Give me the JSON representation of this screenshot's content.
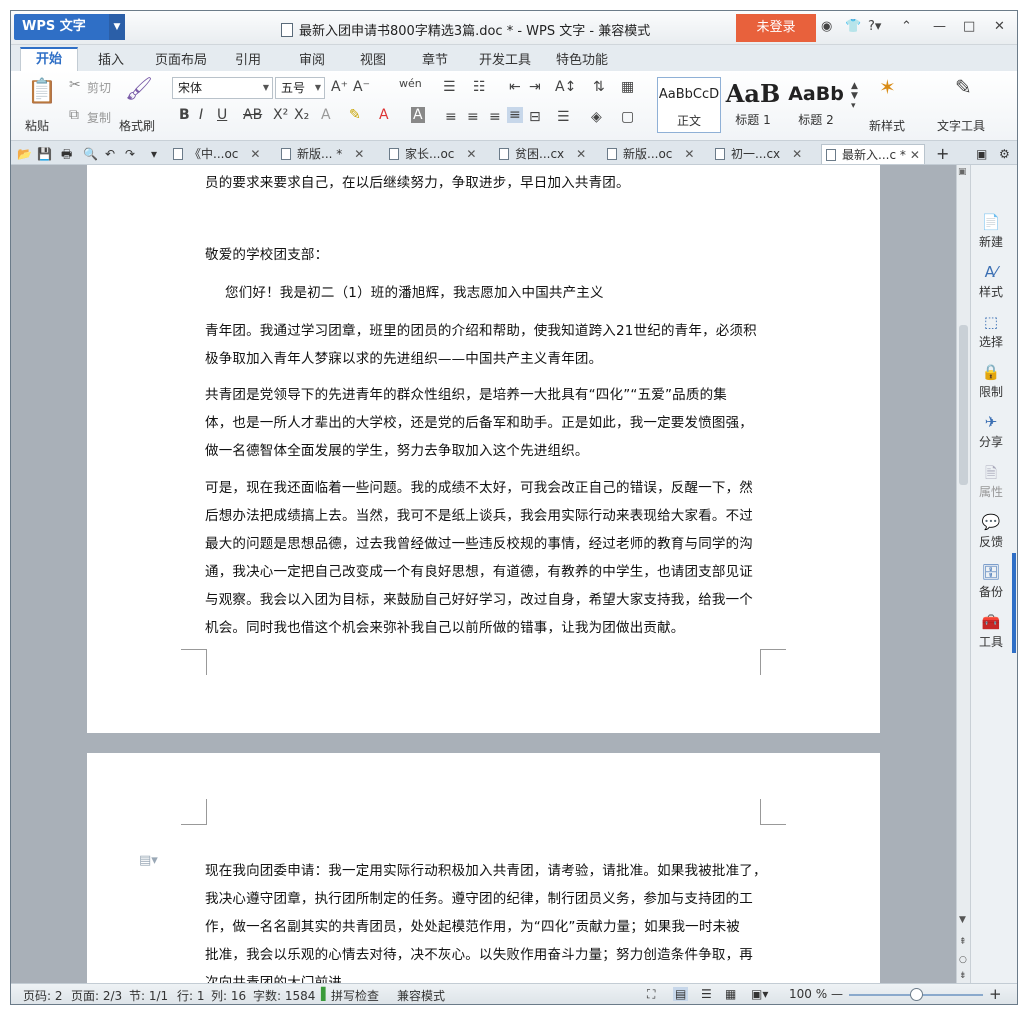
{
  "app": {
    "menu_button": "WPS 文字",
    "window_title": "最新入团申请书800字精选3篇.doc * - WPS 文字 - 兼容模式",
    "login_button": "未登录"
  },
  "ribbon_tabs": [
    "开始",
    "插入",
    "页面布局",
    "引用",
    "审阅",
    "视图",
    "章节",
    "开发工具",
    "特色功能"
  ],
  "ribbon": {
    "paste": "粘贴",
    "cut": "剪切",
    "copy": "复制",
    "format_painter": "格式刷",
    "font_name": "宋体",
    "font_size": "五号",
    "styles": [
      {
        "sample": "AaBbCcD",
        "name": "正文"
      },
      {
        "sample": "AaB",
        "name": "标题 1"
      },
      {
        "sample": "AaBb",
        "name": "标题 2"
      }
    ],
    "new_style": "新样式",
    "text_tools": "文字工具"
  },
  "doc_tabs": [
    {
      "label": "《中...oc",
      "active": false
    },
    {
      "label": "新版... *",
      "active": false
    },
    {
      "label": "家长...oc",
      "active": false
    },
    {
      "label": "贫困...cx",
      "active": false
    },
    {
      "label": "新版...oc",
      "active": false
    },
    {
      "label": "初一...cx",
      "active": false
    },
    {
      "label": "最新入...c *",
      "active": true
    }
  ],
  "document": {
    "page1_lines": [
      "员的要求来要求自己，在以后继续努力，争取进步，早日加入共青团。",
      "敬爱的学校团支部：",
      "您们好！我是初二（1）班的潘旭辉，我志愿加入中国共产主义",
      "青年团。我通过学习团章，班里的团员的介绍和帮助，使我知道跨入21世纪的青年，必须积",
      "极争取加入青年人梦寐以求的先进组织——中国共产主义青年团。",
      "共青团是党领导下的先进青年的群众性组织，是培养一大批具有“四化”“五爱”品质的集",
      "体，也是一所人才辈出的大学校，还是党的后备军和助手。正是如此，我一定要发愤图强，",
      "做一名德智体全面发展的学生，努力去争取加入这个先进组织。",
      "可是，现在我还面临着一些问题。我的成绩不太好，可我会改正自己的错误，反醒一下，然",
      "后想办法把成绩搞上去。当然，我可不是纸上谈兵，我会用实际行动来表现给大家看。不过",
      "最大的问题是思想品德，过去我曾经做过一些违反校规的事情，经过老师的教育与同学的沟",
      "通，我决心一定把自己改变成一个有良好思想，有道德，有教养的中学生，也请团支部见证",
      "与观察。我会以入团为目标，来鼓励自己好好学习，改过自身，希望大家支持我，给我一个",
      "机会。同时我也借这个机会来弥补我自己以前所做的错事，让我为团做出贡献。"
    ],
    "page2_lines": [
      "现在我向团委申请：我一定用实际行动积极加入共青团，请考验，请批准。如果我被批准了，",
      "我决心遵守团章，执行团所制定的任务。遵守团的纪律，制行团员义务，参加与支持团的工",
      "作，做一名名副其实的共青团员，处处起模范作用，为“四化”贡献力量；如果我一时未被",
      "批准，我会以乐观的心情去对待，决不灰心。以失败作用奋斗力量；努力创造条件争取，再",
      "次向共青团的大门前进。"
    ]
  },
  "side_panel": [
    "新建",
    "样式",
    "选择",
    "限制",
    "分享",
    "属性",
    "反馈",
    "备份",
    "工具"
  ],
  "status": {
    "page_num": "页码: 2",
    "pages": "页面: 2/3",
    "section": "节: 1/1",
    "row": "行: 1",
    "col": "列: 16",
    "word_count": "字数: 1584",
    "spell_check": "拼写检查",
    "compat_mode": "兼容模式",
    "zoom": "100 %"
  },
  "zoom_level": 0.5
}
